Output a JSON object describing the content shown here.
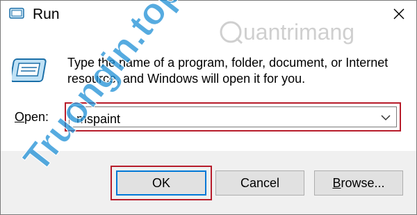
{
  "window": {
    "title": "Run"
  },
  "icons": {
    "app": "run-icon",
    "close": "close-icon",
    "dropdown": "chevron-down-icon"
  },
  "description": "Type the name of a program, folder, document, or Internet resource, and Windows will open it for you.",
  "open_label_prefix": "O",
  "open_label_rest": "pen:",
  "input": {
    "value": "mspaint"
  },
  "buttons": {
    "ok": "OK",
    "cancel": "Cancel",
    "browse_prefix": "B",
    "browse_rest": "rowse..."
  },
  "watermarks": {
    "left": "Truongin.top",
    "right": "uantrimang"
  },
  "colors": {
    "highlight": "#b71c2a",
    "focus": "#0078d7",
    "footer": "#f0f0f0"
  }
}
